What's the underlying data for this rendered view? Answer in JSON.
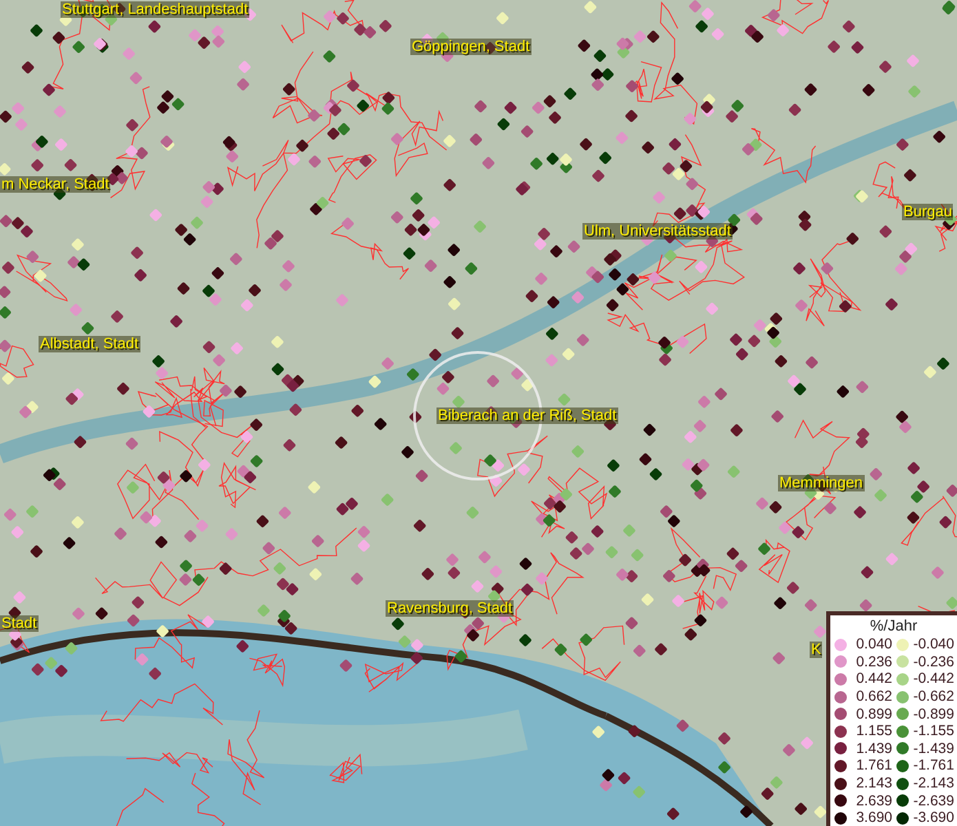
{
  "map": {
    "place_labels": [
      {
        "text": "Stuttgart, Landeshauptstadt"
      },
      {
        "text": "Göppingen, Stadt"
      },
      {
        "text": "m Neckar, Stadt"
      },
      {
        "text": "Ulm, Universitätsstadt"
      },
      {
        "text": "Burgau"
      },
      {
        "text": "Albstadt, Stadt"
      },
      {
        "text": "Biberach an der Riß, Stadt"
      },
      {
        "text": "Memmingen"
      },
      {
        "text": "Ravensburg, Stadt"
      },
      {
        "text": "Stadt"
      },
      {
        "text": "K"
      }
    ]
  },
  "legend": {
    "title": "%/Jahr",
    "entries": [
      {
        "positive": {
          "value": "0.040",
          "color": "#f4b0e4"
        },
        "negative": {
          "value": "-0.040",
          "color": "#eef2b4"
        }
      },
      {
        "positive": {
          "value": "0.236",
          "color": "#e096c8"
        },
        "negative": {
          "value": "-0.236",
          "color": "#c8e2a0"
        }
      },
      {
        "positive": {
          "value": "0.442",
          "color": "#cc7aa8"
        },
        "negative": {
          "value": "-0.442",
          "color": "#a8d488"
        }
      },
      {
        "positive": {
          "value": "0.662",
          "color": "#b86690"
        },
        "negative": {
          "value": "-0.662",
          "color": "#88c270"
        }
      },
      {
        "positive": {
          "value": "0.899",
          "color": "#a44c72"
        },
        "negative": {
          "value": "-0.899",
          "color": "#68aa50"
        }
      },
      {
        "positive": {
          "value": "1.155",
          "color": "#8c3250"
        },
        "negative": {
          "value": "-1.155",
          "color": "#4a9238"
        }
      },
      {
        "positive": {
          "value": "1.439",
          "color": "#782040"
        },
        "negative": {
          "value": "-1.439",
          "color": "#307a28"
        }
      },
      {
        "positive": {
          "value": "1.761",
          "color": "#621828"
        },
        "negative": {
          "value": "-1.761",
          "color": "#1e6418"
        }
      },
      {
        "positive": {
          "value": "2.143",
          "color": "#4a1018"
        },
        "negative": {
          "value": "-2.143",
          "color": "#105010"
        }
      },
      {
        "positive": {
          "value": "2.639",
          "color": "#380810"
        },
        "negative": {
          "value": "-2.639",
          "color": "#083c08"
        }
      },
      {
        "positive": {
          "value": "3.690",
          "color": "#200408"
        },
        "negative": {
          "value": "-3.690",
          "color": "#042804"
        }
      }
    ]
  }
}
